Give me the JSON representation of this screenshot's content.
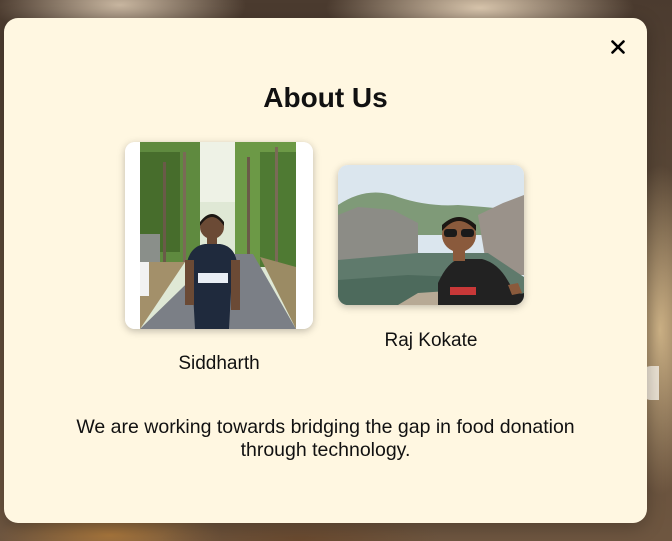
{
  "modal": {
    "title": "About Us",
    "close_icon": "close-icon",
    "description": "We are working towards bridging the gap in food donation through technology."
  },
  "team": [
    {
      "name": "Siddharth",
      "photo": "siddharth-photo"
    },
    {
      "name": "Raj Kokate",
      "photo": "raj-kokate-photo"
    }
  ],
  "colors": {
    "modal_background": "#fff7e1",
    "text": "#111111"
  }
}
